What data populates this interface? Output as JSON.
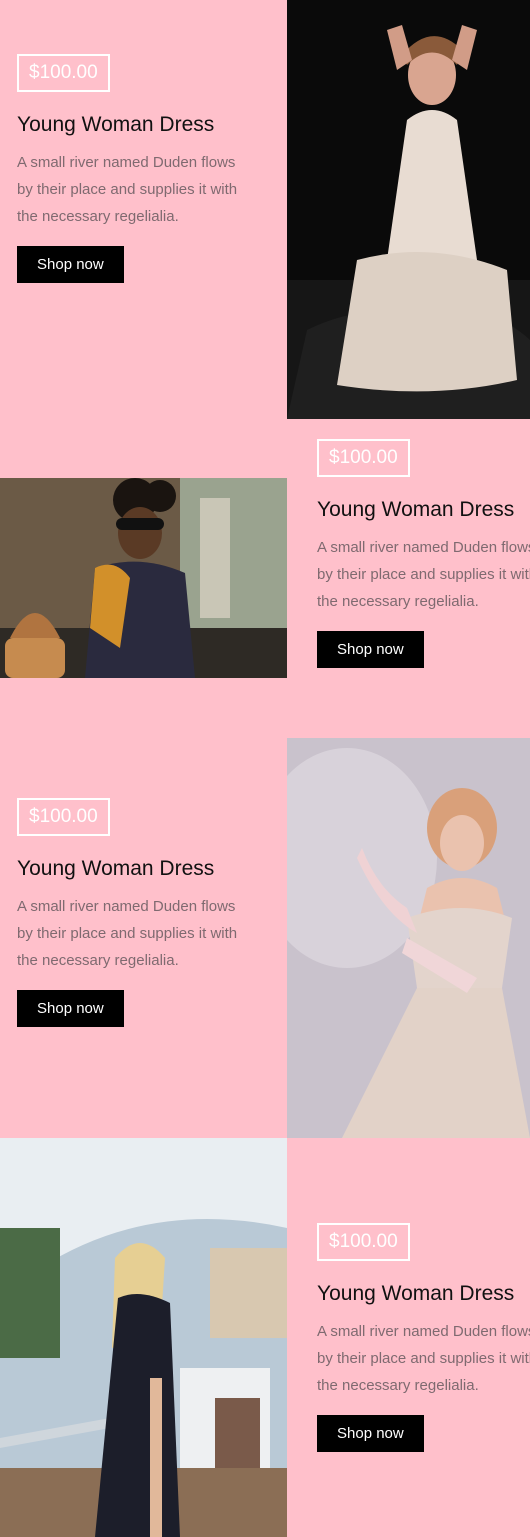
{
  "products": [
    {
      "price": "$100.00",
      "title": "Young Woman Dress",
      "description": "A small river named Duden flows by their place and supplies it with the necessary regelialia.",
      "cta": "Shop now",
      "image": "woman-in-white-pleated-dress-photo"
    },
    {
      "price": "$100.00",
      "title": "Young Woman Dress",
      "description": "A small river named Duden flows by their place and supplies it with the necessary regelialia.",
      "cta": "Shop now",
      "image": "woman-with-sunglasses-and-bag-photo"
    },
    {
      "price": "$100.00",
      "title": "Young Woman Dress",
      "description": "A small river named Duden flows by their place and supplies it with the necessary regelialia.",
      "cta": "Shop now",
      "image": "woman-in-sparkly-gown-photo"
    },
    {
      "price": "$100.00",
      "title": "Young Woman Dress",
      "description": "A small river named Duden flows by their place and supplies it with the necessary regelialia.",
      "cta": "Shop now",
      "image": "woman-on-yacht-photo"
    }
  ],
  "colors": {
    "background": "#ffc0cb",
    "button": "#000000",
    "price_border": "#ffffff",
    "description": "#7f6a70"
  }
}
